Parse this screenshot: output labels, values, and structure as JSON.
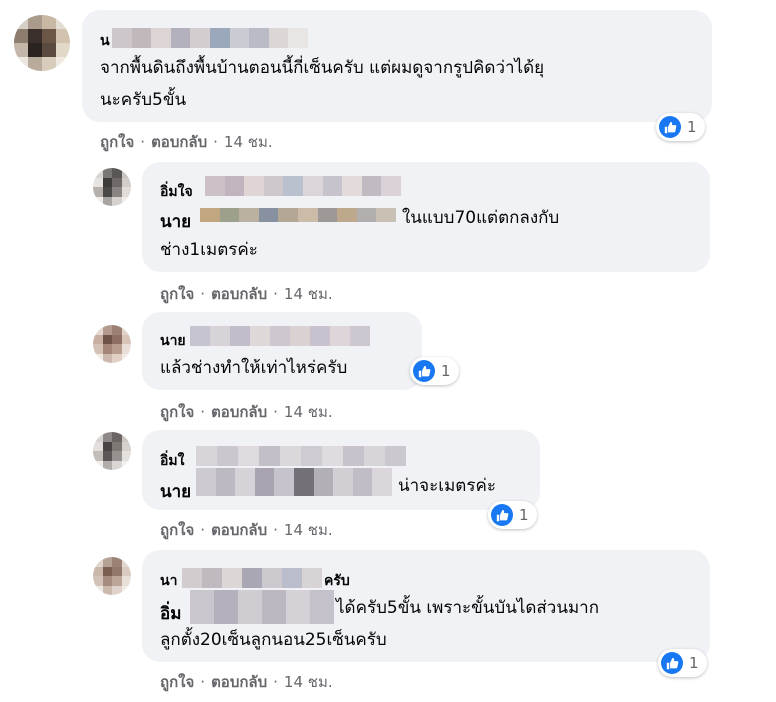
{
  "comments": [
    {
      "author_visible": "น",
      "mention_visible": "",
      "text": "จากพื้นดินถึงพื้นบ้านตอนนี้กี่เซ็นครับ แต่ผมดูจากรูปคิดว่าได้ยุ\nนะครับ5ขั้น",
      "like_label": "ถูกใจ",
      "reply_label": "ตอบกลับ",
      "time": "14 ชม.",
      "reaction_count": "1"
    },
    {
      "author_visible": "อิ่มใจ",
      "mention_visible": "นาย",
      "text_line1": "ในแบบ70แต่ตกลงกับ",
      "text_line2": "ช่าง1เมตรค่ะ",
      "like_label": "ถูกใจ",
      "reply_label": "ตอบกลับ",
      "time": "14 ชม."
    },
    {
      "author_visible": "นาย",
      "text": "แล้วช่างทำให้เท่าไหร่ครับ",
      "like_label": "ถูกใจ",
      "reply_label": "ตอบกลับ",
      "time": "14 ชม.",
      "reaction_count": "1"
    },
    {
      "author_visible": "อิ่มใ",
      "mention_visible": "นาย",
      "text": "น่าจะเมตรค่ะ",
      "like_label": "ถูกใจ",
      "reply_label": "ตอบกลับ",
      "time": "14 ชม.",
      "reaction_count": "1"
    },
    {
      "author_visible": "นา",
      "author_suffix": "ครับ",
      "mention_visible": "อิ่ม",
      "text_line1": "ได้ครับ5ขั้น เพราะขั้นบันไดส่วนมาก",
      "text_line2": "ลูกตั้ง20เซ็นลูกนอน25เซ็นครับ",
      "like_label": "ถูกใจ",
      "reply_label": "ตอบกลับ",
      "time": "14 ชม.",
      "reaction_count": "1"
    }
  ],
  "colors": {
    "bubble": "#f0f2f5",
    "meta": "#65676b",
    "like_blue": "#1877f2"
  },
  "icons": [
    "like-thumb-icon"
  ]
}
